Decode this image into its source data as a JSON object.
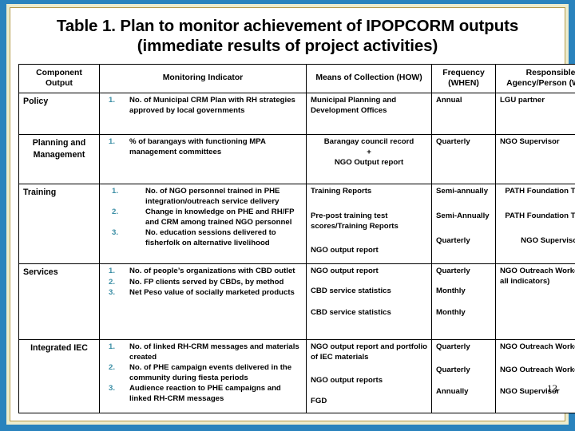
{
  "slide": {
    "title": "Table 1. Plan to monitor achievement of IPOPCORM outputs (immediate results of project activities)",
    "page_number": "13",
    "accent_blue": "#2a83bd",
    "frame_gold": "#b49a4a",
    "frame_cream": "#edeccd",
    "number_color": "#3b8ea5"
  },
  "table": {
    "headers": {
      "component": "Component Output",
      "indicator": "Monitoring Indicator",
      "means": "Means of Collection (HOW)",
      "frequency": "Frequency (WHEN)",
      "responsible": "Responsible Agency/Person (WHO)"
    },
    "rows": [
      {
        "component": "Policy",
        "indicators": [
          {
            "num": "1.",
            "text": "No. of Municipal CRM Plan with RH strategies approved by local governments"
          }
        ],
        "means": [
          "Municipal Planning and Development Offices"
        ],
        "frequency": [
          "Annual"
        ],
        "responsible": [
          "LGU partner"
        ]
      },
      {
        "component": "Planning and Management",
        "indicators": [
          {
            "num": "1.",
            "text": "% of barangays with functioning MPA management committees"
          }
        ],
        "means": [
          "Barangay council record\n+\nNGO Output report"
        ],
        "frequency": [
          "Quarterly"
        ],
        "responsible": [
          "NGO Supervisor"
        ]
      },
      {
        "component": "Training",
        "indicators": [
          {
            "num": "1.",
            "text": "No. of NGO personnel trained in PHE integration/outreach service delivery"
          },
          {
            "num": "2.",
            "text": "Change in knowledge on PHE and RH/FP and CRM among trained NGO personnel"
          },
          {
            "num": "3.",
            "text": "No. education sessions delivered to fisherfolk on alternative livelihood"
          }
        ],
        "means": [
          "Training Reports",
          "Pre-post training test scores/Training Reports",
          "NGO output report"
        ],
        "frequency": [
          "Semi-annually",
          "Semi-Annually",
          "Quarterly"
        ],
        "responsible": [
          "PATH Foundation Trainer",
          "PATH Foundation Trainer",
          "NGO Supervisor"
        ]
      },
      {
        "component": "Services",
        "indicators": [
          {
            "num": "1.",
            "text": "No. of people’s organizations with CBD outlet"
          },
          {
            "num": "2.",
            "text": "No. FP clients served by CBDs, by method"
          },
          {
            "num": "3.",
            "text": "Net Peso value of socially marketed products"
          }
        ],
        "means": [
          "NGO output report",
          "CBD service statistics",
          "CBD service statistics"
        ],
        "frequency": [
          "Quarterly",
          "Monthly",
          "Monthly"
        ],
        "responsible": [
          "NGO Outreach Worker (for all indicators)"
        ]
      },
      {
        "component": "Integrated IEC",
        "indicators": [
          {
            "num": "1.",
            "text": "No. of linked RH-CRM messages and materials created"
          },
          {
            "num": "2.",
            "text": "No. of PHE campaign events delivered in the community during fiesta periods"
          },
          {
            "num": "3.",
            "text": "Audience reaction to PHE campaigns and linked RH-CRM messages"
          }
        ],
        "means": [
          "NGO output report and portfolio of IEC materials",
          "NGO output reports",
          "FGD"
        ],
        "frequency": [
          "Quarterly",
          "Quarterly",
          "Annually"
        ],
        "responsible": [
          "NGO Outreach Worker",
          "NGO Outreach Worker",
          "NGO Supervisor"
        ]
      }
    ]
  }
}
